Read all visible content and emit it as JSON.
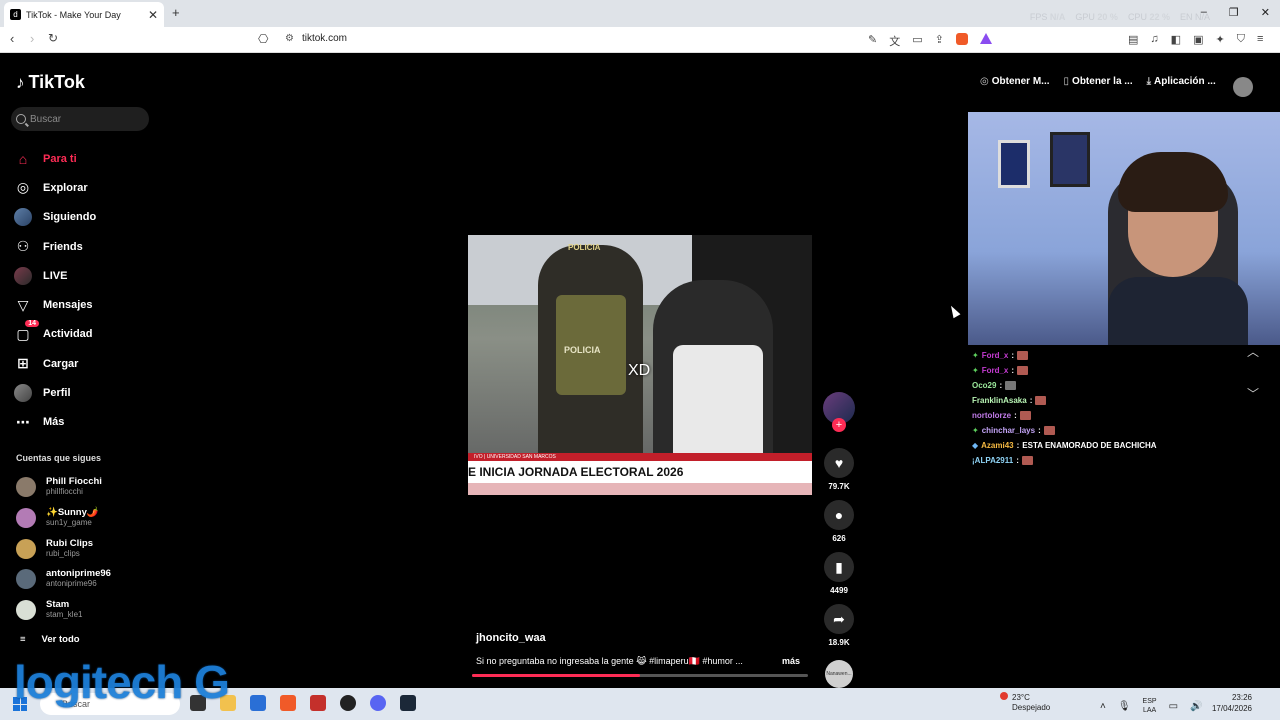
{
  "browser": {
    "tab_title": "TikTok - Make Your Day",
    "tab_fav": "d",
    "url": "tiktok.com",
    "perf": {
      "fps_label": "FPS",
      "fps_value": "N/A",
      "gpu_label": "GPU",
      "gpu_value": "20 %",
      "cpu_label": "CPU",
      "cpu_value": "22 %",
      "extra": "EN N/A"
    }
  },
  "sidebar": {
    "logo": "TikTok",
    "search_placeholder": "Buscar",
    "menu": [
      {
        "label": "Para ti",
        "icon": "home-icon"
      },
      {
        "label": "Explorar",
        "icon": "compass-icon"
      },
      {
        "label": "Siguiendo",
        "icon": "following-avatar-icon"
      },
      {
        "label": "Friends",
        "icon": "friends-icon"
      },
      {
        "label": "LIVE",
        "icon": "live-icon"
      },
      {
        "label": "Mensajes",
        "icon": "send-icon"
      },
      {
        "label": "Actividad",
        "icon": "inbox-icon",
        "badge": "14"
      },
      {
        "label": "Cargar",
        "icon": "upload-icon"
      },
      {
        "label": "Perfil",
        "icon": "profile-avatar-icon"
      },
      {
        "label": "Más",
        "icon": "more-icon"
      }
    ],
    "following_title": "Cuentas que sigues",
    "following": [
      {
        "name": "Phill Fiocchi",
        "user": "phillfiocchi",
        "color": "#8a7a6a"
      },
      {
        "name": "✨Sunny🌶️",
        "user": "sun1y_game",
        "color": "#b37bb5"
      },
      {
        "name": "Rubi Clips",
        "user": "rubi_clips",
        "color": "#c8a156"
      },
      {
        "name": "antoniprime96",
        "user": "antoniprime96",
        "color": "#5a6a7a"
      },
      {
        "name": "Stam",
        "user": "stam_kle1",
        "color": "#d9dfd5"
      }
    ],
    "see_all": "Ver todo"
  },
  "video": {
    "overlay_text": "XD",
    "cap_text": "POLICIA",
    "vest_text": "POLICIA",
    "ticker_small": "IVO | UNIVERSIDAD SAN MARCOS",
    "ticker_main": "E INICIA JORNADA ELECTORAL 2026",
    "author": "jhoncito_waa",
    "caption": "Si no preguntaba no ingresaba la gente 😹 #limaperu🇵🇪 #humor ...",
    "more": "más",
    "progress": 0.5
  },
  "actions": {
    "like_count": "79.7K",
    "comment_count": "626",
    "save_count": "4499",
    "share_count": "18.9K",
    "disc_label": "Nanawen..."
  },
  "topbar": {
    "btn1": "Obtener M...",
    "btn2": "Obtener la ...",
    "btn3": "Aplicación ..."
  },
  "chat": [
    {
      "user": "Ford_x",
      "color": "#c43bd1",
      "msg": "",
      "prefix": "✦"
    },
    {
      "user": "Ford_x",
      "color": "#c43bd1",
      "msg": "",
      "prefix": "✦"
    },
    {
      "user": "Oco29",
      "color": "#9be89b",
      "msg": "",
      "prefix": ""
    },
    {
      "user": "FranklinAsaka",
      "color": "#b9f5b5",
      "msg": "",
      "prefix": ""
    },
    {
      "user": "nortolorze",
      "color": "#c17be8",
      "msg": "",
      "prefix": ""
    },
    {
      "user": "chinchar_lays",
      "color": "#c2a3f5",
      "msg": "",
      "prefix": "✦"
    },
    {
      "user": "Azami43",
      "color": "#f5b942",
      "msg": "ESTA ENAMORADO DE BACHICHA",
      "prefix": "◆"
    },
    {
      "user": "¡ALPA2911",
      "color": "#8fd3f5",
      "msg": "",
      "prefix": ""
    }
  ],
  "taskbar": {
    "search": "Buscar",
    "temp": "23°C",
    "weather": "Despejado",
    "lang1": "ESP",
    "lang2": "LAA",
    "time": "23:26",
    "date": "17/04/2026"
  },
  "watermark": "logitech G",
  "colors": {
    "accent": "#fe2c55",
    "bg": "#000000"
  }
}
